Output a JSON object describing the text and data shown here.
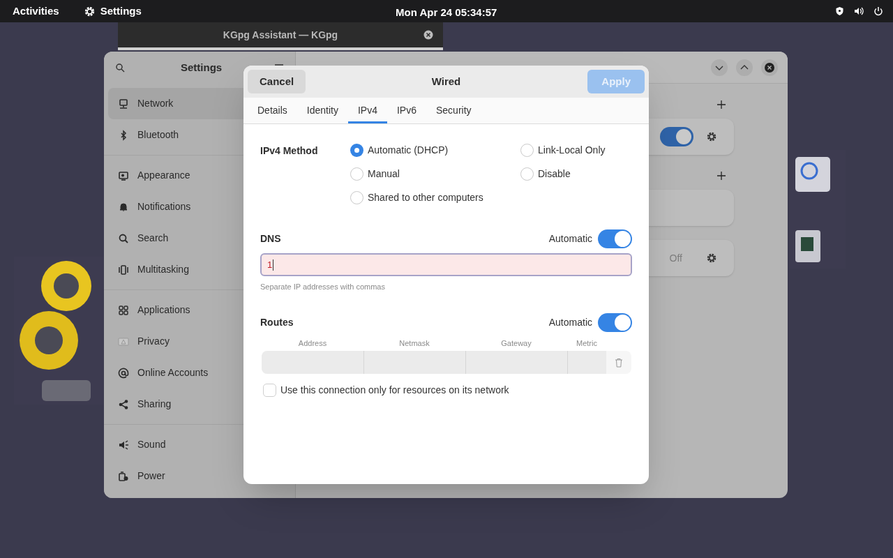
{
  "top_bar": {
    "activities": "Activities",
    "app_name": "Settings",
    "clock": "Mon Apr 24  05:34:57"
  },
  "background_window": {
    "title": "KGpg Assistant — KGpg"
  },
  "settings": {
    "sidebar": {
      "title": "Settings",
      "groups": [
        [
          {
            "label": "Network",
            "selected": true
          },
          {
            "label": "Bluetooth",
            "selected": false
          }
        ],
        [
          {
            "label": "Appearance",
            "selected": false
          },
          {
            "label": "Notifications",
            "selected": false
          },
          {
            "label": "Search",
            "selected": false
          },
          {
            "label": "Multitasking",
            "selected": false
          }
        ],
        [
          {
            "label": "Applications",
            "selected": false
          },
          {
            "label": "Privacy",
            "selected": false
          },
          {
            "label": "Online Accounts",
            "selected": false
          },
          {
            "label": "Sharing",
            "selected": false
          }
        ],
        [
          {
            "label": "Sound",
            "selected": false
          },
          {
            "label": "Power",
            "selected": false
          }
        ]
      ]
    },
    "panel": {
      "cards": [
        {
          "kind": "toggle",
          "on": true,
          "add_above": true
        },
        {
          "kind": "empty",
          "add_above": true
        },
        {
          "kind": "status",
          "status": "Off",
          "add_above": false
        }
      ]
    }
  },
  "dialog": {
    "title": "Wired",
    "cancel": "Cancel",
    "apply": {
      "label": "Apply",
      "disabled": true
    },
    "tabs": [
      {
        "label": "Details",
        "selected": false
      },
      {
        "label": "Identity",
        "selected": false
      },
      {
        "label": "IPv4",
        "selected": true
      },
      {
        "label": "IPv6",
        "selected": false
      },
      {
        "label": "Security",
        "selected": false
      }
    ],
    "method": {
      "label": "IPv4 Method",
      "options": [
        {
          "label": "Automatic (DHCP)",
          "selected": true
        },
        {
          "label": "Link-Local Only",
          "selected": false
        },
        {
          "label": "Manual",
          "selected": false
        },
        {
          "label": "Disable",
          "selected": false
        },
        {
          "label": "Shared to other computers",
          "selected": false
        }
      ]
    },
    "dns": {
      "label": "DNS",
      "automatic_label": "Automatic",
      "automatic": true,
      "value": "1",
      "invalid": true,
      "hint": "Separate IP addresses with commas"
    },
    "routes": {
      "label": "Routes",
      "automatic_label": "Automatic",
      "automatic": true,
      "columns": [
        "Address",
        "Netmask",
        "Gateway",
        "Metric"
      ]
    },
    "only_local": {
      "label": "Use this connection only for resources on its network",
      "checked": false
    }
  }
}
